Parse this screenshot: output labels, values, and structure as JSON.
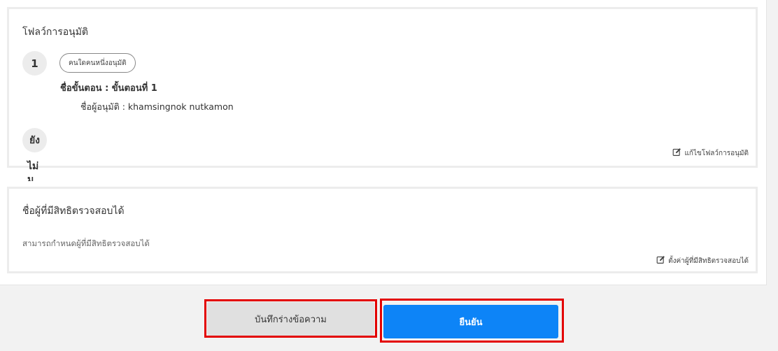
{
  "approval_flow": {
    "title": "โฟลว์การอนุมัติ",
    "steps": [
      {
        "number": "1",
        "mode_badge": "คนใดคนหนึ่งอนุมัติ",
        "name": "ชื่อขั้นตอน : ขั้นตอนที่ 1",
        "approver": "ชื่อผู้อนุมัติ : khamsingnok nutkamon"
      },
      {
        "number": "ยัง",
        "overflow_line_1": "ไม่",
        "overflow_line_2": "มี"
      }
    ],
    "edit_label": "แก้ไขโฟลว์การอนุมัติ",
    "edit_icon": "edit-icon"
  },
  "reviewers": {
    "title": "ชื่อผู้ที่มีสิทธิตรวจสอบได้",
    "hint": "สามารถกำหนดผู้ที่มีสิทธิตรวจสอบได้",
    "edit_label": "ตั้งค่าผู้ที่มีสิทธิตรวจสอบได้",
    "edit_icon": "edit-icon"
  },
  "actions": {
    "save_draft_label": "บันทึกร่างข้อความ",
    "confirm_label": "ยืนยัน"
  },
  "colors": {
    "confirm": "#0d84f7",
    "draft": "#e0e0e0",
    "highlight": "#e30000"
  }
}
